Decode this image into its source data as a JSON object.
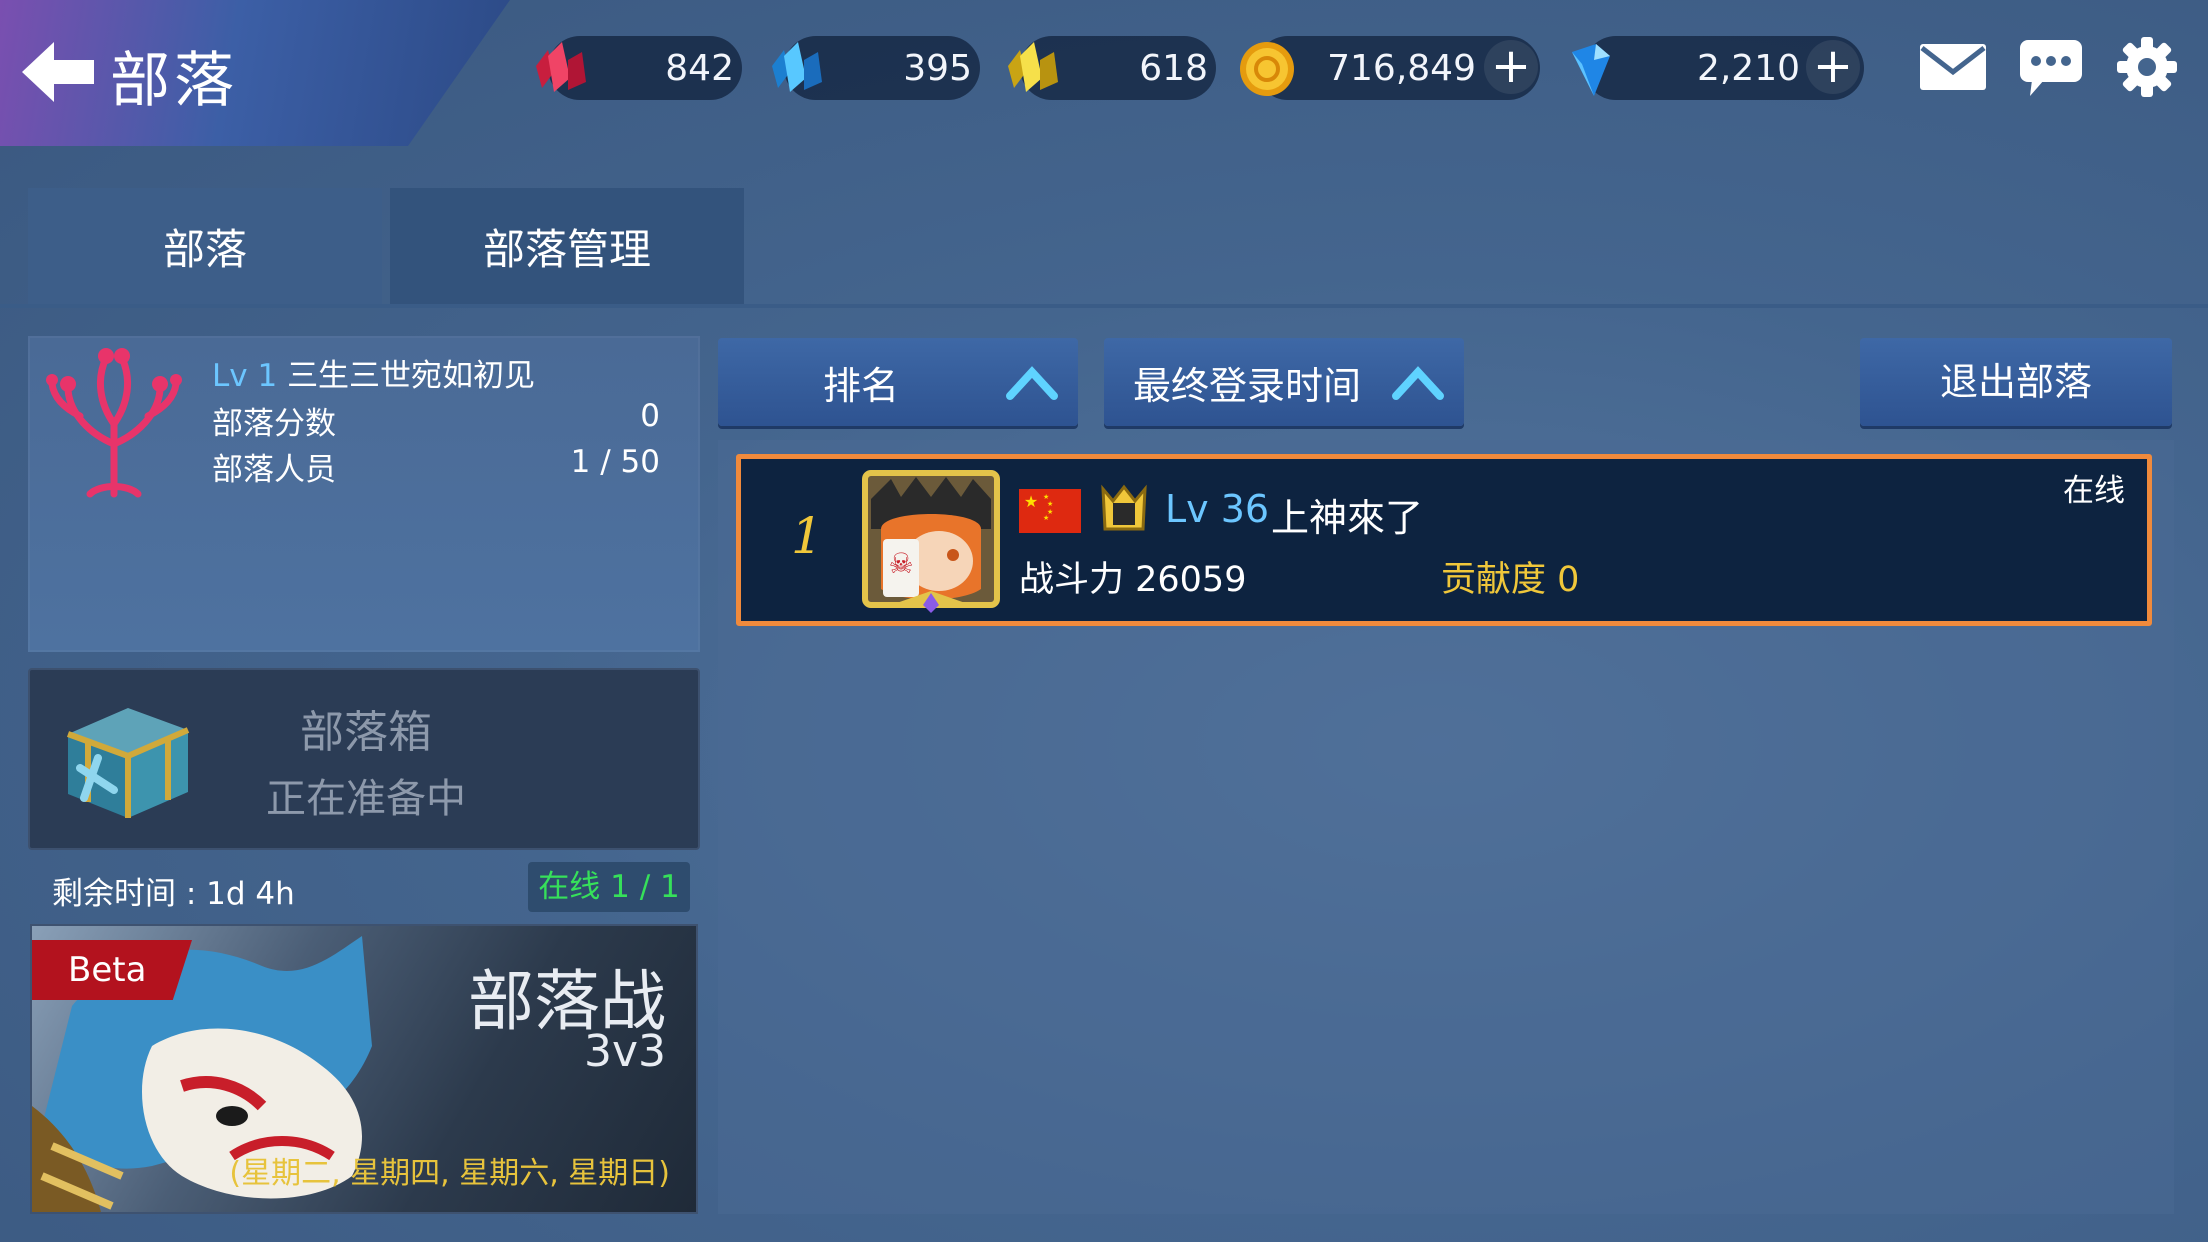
{
  "header": {
    "title": "部落",
    "back_icon": "back-arrow-icon"
  },
  "currencies": [
    {
      "icon": "red-crystal-icon",
      "value": "842",
      "color": "#e8304f"
    },
    {
      "icon": "blue-crystal-icon",
      "value": "395",
      "color": "#2aa8f0"
    },
    {
      "icon": "gold-crystal-icon",
      "value": "618",
      "color": "#f0d23a"
    },
    {
      "icon": "gold-coin-icon",
      "value": "716,849",
      "color": "#f2b41c"
    },
    {
      "icon": "blue-gem-icon",
      "value": "2,210",
      "color": "#2d8ce8"
    }
  ],
  "top_icons": [
    "mail-icon",
    "chat-icon",
    "gear-icon"
  ],
  "tabs": [
    {
      "label": "部落",
      "active": true
    },
    {
      "label": "部落管理",
      "active": false
    }
  ],
  "clan": {
    "level": "Lv 1",
    "name": "三生三世宛如初见",
    "score_label": "部落分数",
    "score_value": "0",
    "members_label": "部落人员",
    "members_value": "1 / 50",
    "emblem_icon": "clan-tree-emblem-icon"
  },
  "clan_box": {
    "title": "部落箱",
    "status": "正在准备中",
    "remaining": "剩余时间 : 1d 4h",
    "online": "在线 1 / 1"
  },
  "clan_war": {
    "badge": "Beta",
    "title": "部落战",
    "mode": "3v3",
    "days": "(星期二, 星期四, 星期六, 星期日)"
  },
  "sort": {
    "rank_label": "排名",
    "login_label": "最终登录时间",
    "quit_label": "退出部落"
  },
  "members": [
    {
      "rank": "1",
      "level": "Lv 36",
      "name": "上神來了",
      "power": "战斗力 26059",
      "contribution": "贡献度 0",
      "status": "在线"
    }
  ],
  "colors": {
    "accent_blue": "#6cc6ff",
    "highlight_orange": "#f08a3c",
    "gold_text": "#f0c73a",
    "online_green": "#36e05a"
  }
}
